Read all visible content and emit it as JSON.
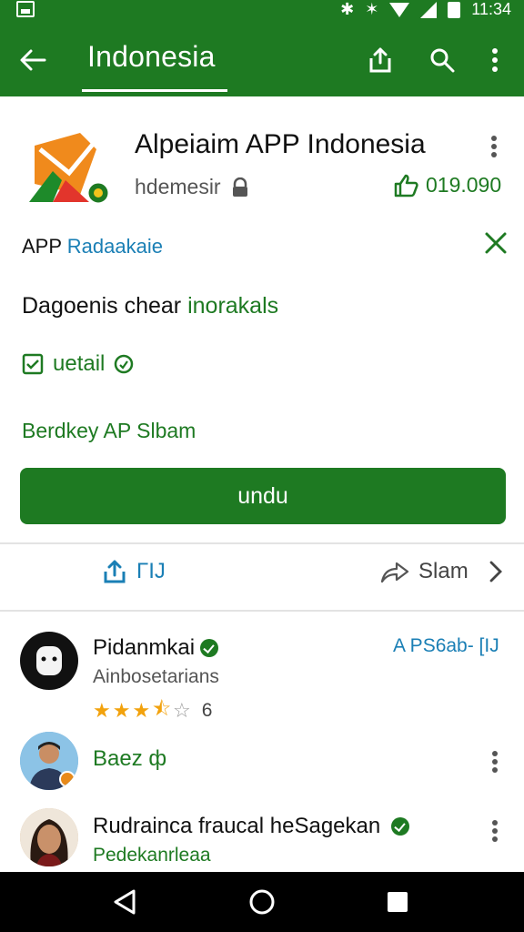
{
  "status_bar": {
    "time": "11:34"
  },
  "toolbar": {
    "title": "Indonesia"
  },
  "app": {
    "title": "Alpeiaim APP Indonesia",
    "publisher": "hdemesir",
    "count": "019.090"
  },
  "info": {
    "title_prefix": "APP",
    "title_highlight": "Radaakaie",
    "description_prefix": "Dagoenis chear",
    "description_highlight": "inorakals",
    "detail_label": "uetail",
    "feature_label": "Berdkey AP Slbam",
    "install_label": "undu"
  },
  "actions": {
    "share_label": "ΓIJ",
    "slam_label": "Slam"
  },
  "reviews": [
    {
      "name": "Pidanmkai",
      "subtitle": "Ainbosetarians",
      "rating": 3.5,
      "rating_count": "6",
      "tag": "A PS6ab- [IJ"
    },
    {
      "name": "Baez ф"
    },
    {
      "name": "Rudrainca fraucal heSagekan",
      "subtitle": "Pedekanrleaa"
    }
  ],
  "colors": {
    "primary": "#1e7a22",
    "link": "#1a7fb5",
    "star": "#f2a20d"
  }
}
